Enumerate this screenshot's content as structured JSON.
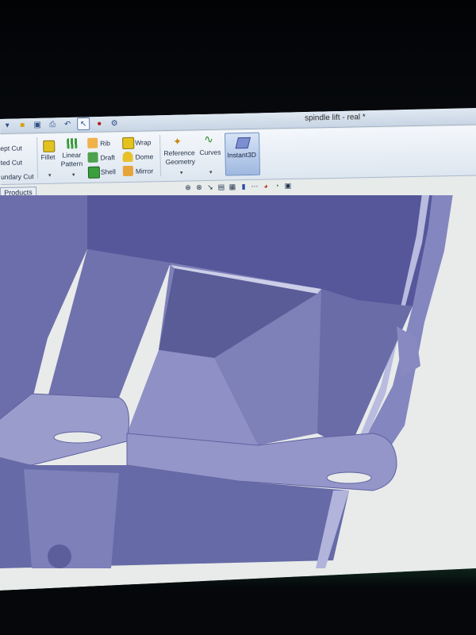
{
  "window": {
    "title": "spindle lift - real *"
  },
  "quick_access": {
    "icons": [
      "new-icon",
      "open-icon",
      "save-icon",
      "print-icon",
      "undo-icon",
      "select-icon",
      "rebuild-icon",
      "options-icon"
    ]
  },
  "ribbon": {
    "cut_group": {
      "swept_cut": "ept Cut",
      "lofted_cut": "ted Cut",
      "boundary_cut": "undary Cut"
    },
    "fillet": "Fillet",
    "linear_pattern_line1": "Linear",
    "linear_pattern_line2": "Pattern",
    "rib": "Rib",
    "draft": "Draft",
    "shell": "Shell",
    "wrap": "Wrap",
    "dome": "Dome",
    "mirror": "Mirror",
    "reference_geometry_line1": "Reference",
    "reference_geometry_line2": "Geometry",
    "curves": "Curves",
    "instant3d": "Instant3D"
  },
  "tabs": {
    "products": "Products"
  },
  "heads_up_toolbar": {
    "icons": [
      "zoom-to-fit-icon",
      "zoom-area-icon",
      "previous-view-icon",
      "section-view-icon",
      "view-orientation-icon",
      "display-style-icon",
      "hide-show-icon",
      "appearance-icon",
      "scene-icon",
      "view-settings-icon"
    ]
  },
  "colors": {
    "model_face_dark": "#5a5c98",
    "model_face_mid": "#7476b0",
    "model_face_light": "#a6a8d2",
    "ribbon_bg": "#e6edf5",
    "viewport_bg": "#e9ecea"
  }
}
